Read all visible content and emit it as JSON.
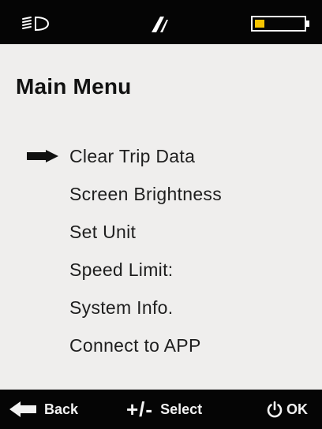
{
  "statusbar": {
    "icons": [
      "headlight-icon",
      "riding-mode-icon",
      "battery-icon"
    ],
    "battery_level": 0.2,
    "battery_fill_color": "#f5c400"
  },
  "main": {
    "title": "Main Menu",
    "selected_index": 0,
    "items": [
      {
        "label": "Clear Trip Data"
      },
      {
        "label": "Screen Brightness"
      },
      {
        "label": "Set Unit"
      },
      {
        "label": "Speed Limit:"
      },
      {
        "label": "System Info."
      },
      {
        "label": "Connect to APP"
      }
    ]
  },
  "footer": {
    "back_label": "Back",
    "select_symbol": "+/-",
    "select_label": "Select",
    "ok_label": "OK"
  }
}
